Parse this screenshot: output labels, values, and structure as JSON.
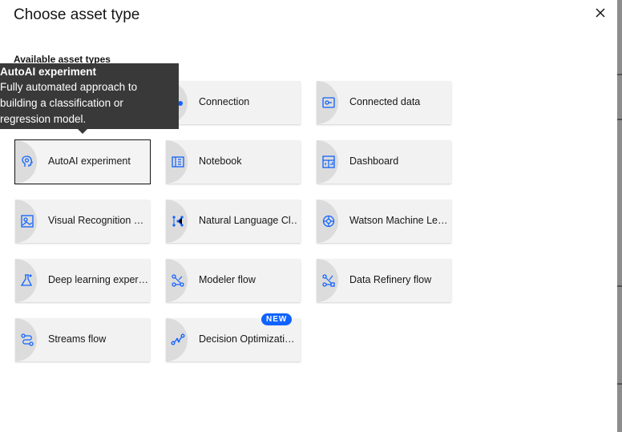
{
  "dialog": {
    "title": "Choose asset type",
    "section_label": "Available asset types"
  },
  "tooltip": {
    "title": "AutoAI experiment",
    "lines": [
      "Fully automated approach to",
      "building a classification or",
      "regression model."
    ]
  },
  "tiles": [
    {
      "label": "Connection",
      "icon": "connection-icon"
    },
    {
      "label": "Connected data",
      "icon": "connected-data-icon"
    },
    {
      "label": "AutoAI experiment",
      "icon": "autoai-icon",
      "focused": true
    },
    {
      "label": "Notebook",
      "icon": "notebook-icon"
    },
    {
      "label": "Dashboard",
      "icon": "dashboard-icon"
    },
    {
      "label": "Visual Recognition …",
      "icon": "visual-recognition-icon"
    },
    {
      "label": "Natural Language Cl…",
      "icon": "natural-language-icon"
    },
    {
      "label": "Watson Machine Le…",
      "icon": "watson-ml-icon"
    },
    {
      "label": "Deep learning exper…",
      "icon": "deep-learning-icon"
    },
    {
      "label": "Modeler flow",
      "icon": "modeler-flow-icon"
    },
    {
      "label": "Data Refinery flow",
      "icon": "data-refinery-icon"
    },
    {
      "label": "Streams flow",
      "icon": "streams-flow-icon"
    },
    {
      "label": "Decision Optimizati…",
      "icon": "decision-optimization-icon",
      "badge": "NEW"
    }
  ],
  "colors": {
    "accent": "#0f62fe",
    "tooltip_bg": "#393939",
    "tile_bg": "#f2f2f2"
  }
}
